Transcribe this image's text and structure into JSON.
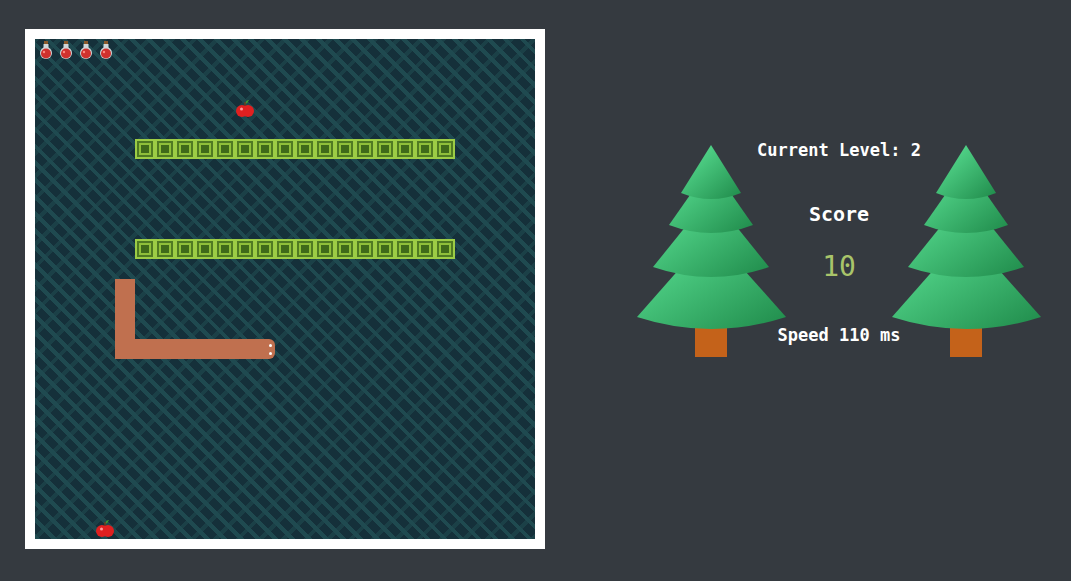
{
  "game": {
    "grid": {
      "columns": 25,
      "rows": 25
    },
    "lives": 4,
    "apples": [
      {
        "col": 10,
        "row": 3
      },
      {
        "col": 3,
        "row": 24
      }
    ],
    "walls": [
      {
        "row": 5,
        "from_col": 5,
        "to_col": 20
      },
      {
        "row": 10,
        "from_col": 5,
        "to_col": 20
      }
    ],
    "snake": {
      "direction": "right",
      "cells": [
        [
          4,
          12
        ],
        [
          4,
          13
        ],
        [
          4,
          14
        ],
        [
          4,
          15
        ],
        [
          5,
          15
        ],
        [
          6,
          15
        ],
        [
          7,
          15
        ],
        [
          8,
          15
        ],
        [
          9,
          15
        ],
        [
          10,
          15
        ],
        [
          11,
          15
        ]
      ]
    }
  },
  "panel": {
    "level": "Current Level: 2",
    "score_label": "Score",
    "score": "10",
    "speed": "Speed 110 ms"
  }
}
